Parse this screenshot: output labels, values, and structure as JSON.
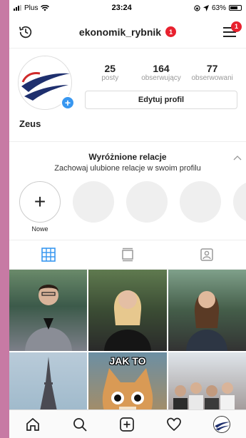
{
  "status_bar": {
    "carrier": "Plus",
    "time": "23:24",
    "battery": "63%"
  },
  "header": {
    "username": "ekonomik_rybnik",
    "notification_count": "1",
    "menu_badge_count": "1"
  },
  "profile": {
    "display_name": "Zeus",
    "stats": [
      {
        "value": "25",
        "label": "posty"
      },
      {
        "value": "164",
        "label": "obserwujący"
      },
      {
        "value": "77",
        "label": "obserwowani"
      }
    ],
    "edit_button": "Edytuj profil",
    "add_photo_symbol": "+"
  },
  "highlights": {
    "title": "Wyróżnione relacje",
    "subtitle": "Zachowaj ulubione relacje w swoim profilu",
    "new_label": "Nowe",
    "new_symbol": "+"
  },
  "tabs": [
    {
      "icon": "grid-icon",
      "active": true
    },
    {
      "icon": "feed-icon",
      "active": false
    },
    {
      "icon": "tagged-icon",
      "active": false
    }
  ],
  "posts": [
    {
      "meme_text": ""
    },
    {
      "meme_text": ""
    },
    {
      "meme_text": ""
    },
    {
      "meme_text": ""
    },
    {
      "meme_text": "JAK TO"
    },
    {
      "meme_text": ""
    }
  ],
  "bottom_nav": [
    "home-icon",
    "search-icon",
    "new-post-icon",
    "activity-icon",
    "profile-avatar"
  ],
  "colors": {
    "accent": "#3897f0",
    "badge": "#e8212e",
    "page_background": "#c77aa4"
  }
}
